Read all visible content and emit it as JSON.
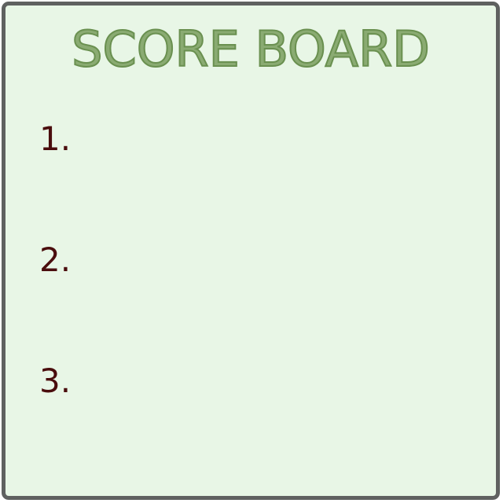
{
  "scoreboard": {
    "title": "SCORE BOARD",
    "entries": [
      {
        "rank": "1.",
        "value": ""
      },
      {
        "rank": "2.",
        "value": ""
      },
      {
        "rank": "3.",
        "value": ""
      }
    ]
  },
  "colors": {
    "background": "#e8f6e6",
    "border": "#5f6160",
    "title": "#8aab72",
    "rank_text": "#4a0d0d"
  }
}
